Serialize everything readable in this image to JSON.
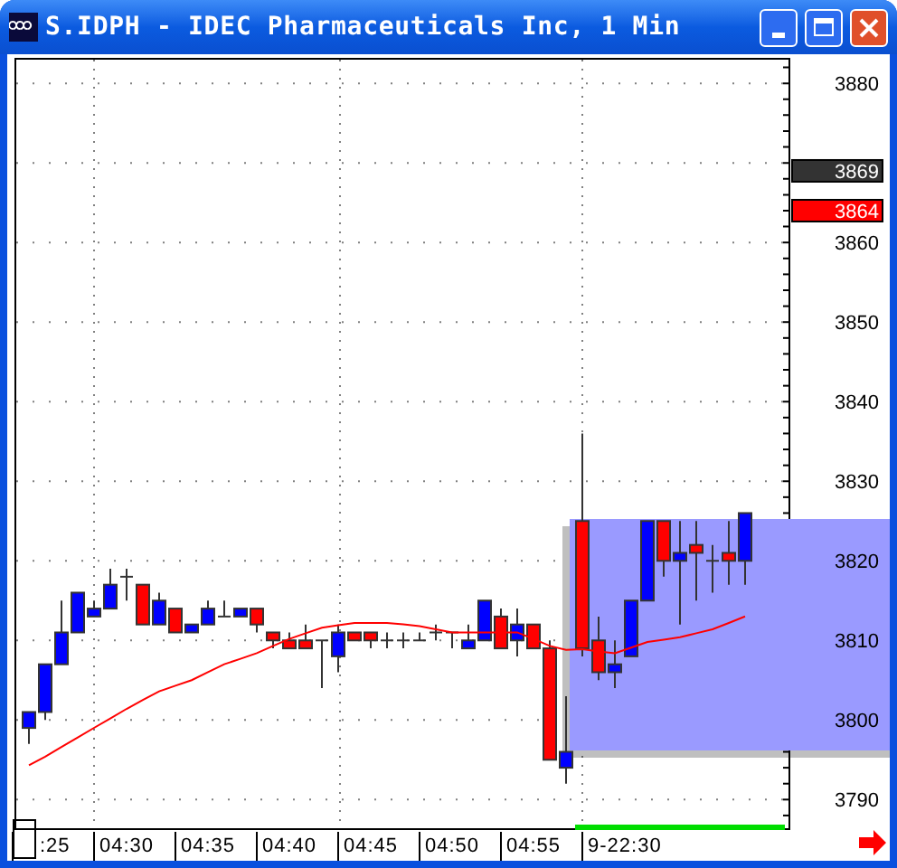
{
  "window": {
    "title": "S.IDPH - IDEC Pharmaceuticals Inc, 1 Min"
  },
  "chart": {
    "price_markers": [
      {
        "label": "3869",
        "color": "#333333"
      },
      {
        "label": "3864",
        "color": "#ff0000"
      }
    ],
    "time_labels": [
      {
        "label": ":25"
      },
      {
        "label": "04:30"
      },
      {
        "label": "04:35"
      },
      {
        "label": "04:40"
      },
      {
        "label": "04:45"
      },
      {
        "label": "04:50"
      },
      {
        "label": "04:55"
      },
      {
        "label": "9-22:30"
      }
    ],
    "chart_data": {
      "type": "candlestick",
      "grid": true,
      "ylim": [
        3786.4,
        3883.2
      ],
      "yticks": [
        3790,
        3800,
        3810,
        3820,
        3830,
        3840,
        3850,
        3860,
        3880
      ],
      "ohlc": [
        [
          3799,
          3801,
          3797,
          3801
        ],
        [
          3801,
          3807,
          3800,
          3807
        ],
        [
          3807,
          3815,
          3807,
          3811
        ],
        [
          3811,
          3816,
          3811,
          3816
        ],
        [
          3813,
          3815,
          3813,
          3814
        ],
        [
          3814,
          3819,
          3814,
          3817
        ],
        [
          3818,
          3819,
          3815,
          3818
        ],
        [
          3817,
          3817,
          3812,
          3812
        ],
        [
          3812,
          3816,
          3812,
          3815
        ],
        [
          3814,
          3814,
          3811,
          3811
        ],
        [
          3811,
          3812,
          3811,
          3812
        ],
        [
          3812,
          3815,
          3812,
          3814
        ],
        [
          3813,
          3815,
          3813,
          3813
        ],
        [
          3813,
          3814,
          3813,
          3814
        ],
        [
          3814,
          3814,
          3811,
          3812
        ],
        [
          3811,
          3811,
          3809,
          3810
        ],
        [
          3810,
          3811,
          3809,
          3809
        ],
        [
          3810,
          3812,
          3809,
          3809
        ],
        [
          3810,
          3810,
          3804,
          3810
        ],
        [
          3808,
          3812,
          3806,
          3811
        ],
        [
          3811,
          3811,
          3810,
          3810
        ],
        [
          3811,
          3811,
          3809,
          3810
        ],
        [
          3810,
          3811,
          3809,
          3810
        ],
        [
          3810,
          3811,
          3809,
          3810
        ],
        [
          3810,
          3811,
          3810,
          3810
        ],
        [
          3811,
          3812,
          3810,
          3811
        ],
        [
          3811,
          3811,
          3809,
          3811
        ],
        [
          3809,
          3812,
          3809,
          3810
        ],
        [
          3810,
          3815,
          3810,
          3815
        ],
        [
          3813,
          3814,
          3809,
          3809
        ],
        [
          3810,
          3814,
          3808,
          3812
        ],
        [
          3812,
          3812,
          3809,
          3809
        ],
        [
          3809,
          3810,
          3795,
          3795
        ],
        [
          3794,
          3803,
          3792,
          3796
        ],
        [
          3825,
          3836,
          3808,
          3809
        ],
        [
          3810,
          3813,
          3805,
          3806
        ],
        [
          3806,
          3810,
          3804,
          3807
        ],
        [
          3808,
          3815,
          3808,
          3815
        ],
        [
          3815,
          3825,
          3815,
          3825
        ],
        [
          3825,
          3825,
          3818,
          3820
        ],
        [
          3820,
          3825,
          3812,
          3821
        ],
        [
          3822,
          3825,
          3815,
          3821
        ],
        [
          3820,
          3822,
          3816,
          3820
        ],
        [
          3821,
          3825,
          3817,
          3820
        ],
        [
          3820,
          3826,
          3817,
          3826
        ]
      ],
      "series": [
        {
          "type": "line",
          "color": "#ff0000",
          "values": [
            3794.3,
            3795.4,
            3796.6,
            3797.8,
            3799,
            3800.2,
            3801.4,
            3802.5,
            3803.6,
            3804.3,
            3805,
            3806,
            3807,
            3807.7,
            3808.4,
            3809.3,
            3810.2,
            3810.9,
            3811.6,
            3811.9,
            3812.2,
            3812.2,
            3812.2,
            3812,
            3811.8,
            3811.4,
            3811,
            3811,
            3811,
            3811,
            3811,
            3810.2,
            3809.3,
            3808.8,
            3808.9,
            3808.6,
            3808.4,
            3809.1,
            3809.8,
            3810.1,
            3810.4,
            3810.9,
            3811.4,
            3812.2,
            3813
          ]
        }
      ]
    }
  }
}
